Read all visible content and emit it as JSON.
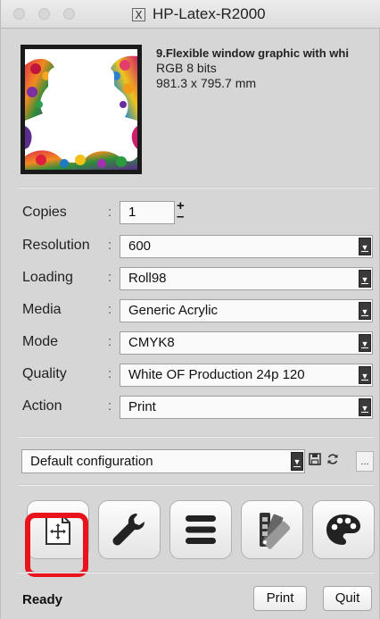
{
  "window": {
    "title": "HP-Latex-R2000",
    "x_icon": "X"
  },
  "job": {
    "file_name": "9.Flexible window graphic with whi",
    "color_mode": "RGB 8 bits",
    "size": "981.3 x 795.7 mm",
    "thumbnail": "floral-frame-thumbnail"
  },
  "settings": {
    "copies_label": "Copies",
    "copies_value": "1",
    "colon": ":",
    "rows": [
      {
        "label": "Resolution",
        "value": "600"
      },
      {
        "label": "Loading",
        "value": "Roll98"
      },
      {
        "label": "Media",
        "value": "Generic Acrylic"
      },
      {
        "label": "Mode",
        "value": "CMYK8"
      },
      {
        "label": "Quality",
        "value": "White OF Production 24p 120"
      },
      {
        "label": "Action",
        "value": "Print"
      }
    ]
  },
  "configuration": {
    "value": "Default configuration",
    "more_label": "..."
  },
  "toolbar": {
    "icons": [
      "layout-icon",
      "wrench-icon",
      "menu-icon",
      "swatch-fan-icon",
      "palette-icon"
    ]
  },
  "footer": {
    "status": "Ready",
    "print_label": "Print",
    "quit_label": "Quit"
  },
  "colors": {
    "highlight": "#e8131c",
    "background": "#d6d6d6"
  }
}
